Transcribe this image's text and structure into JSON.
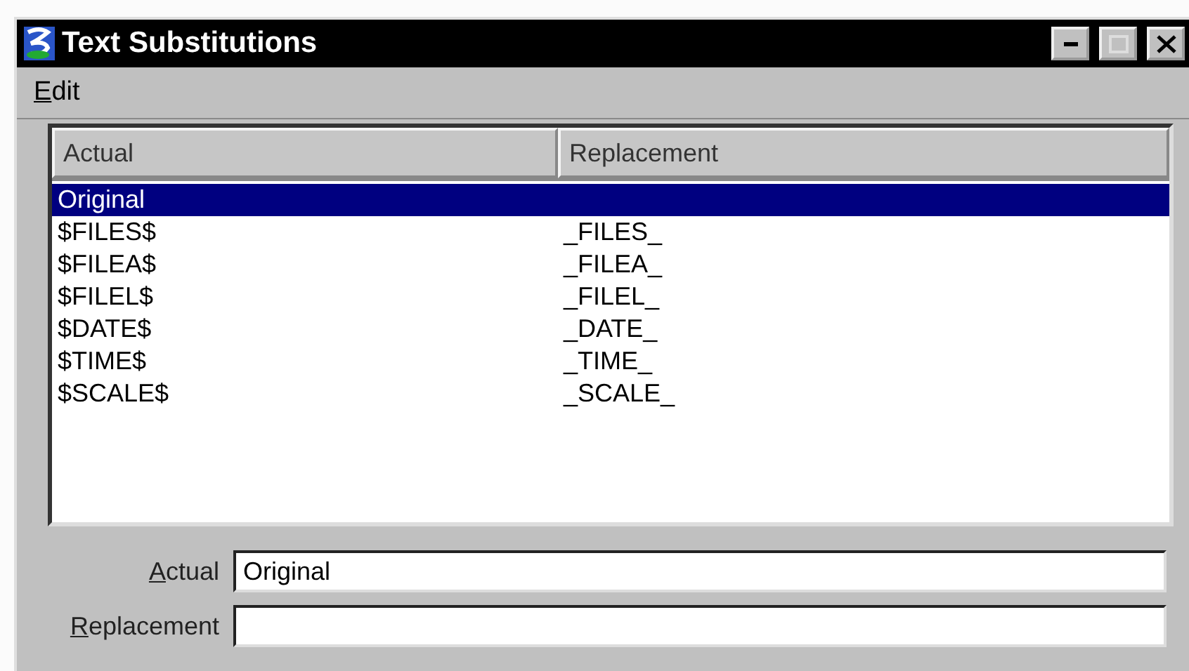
{
  "window": {
    "title": "Text Substitutions",
    "controls": [
      {
        "kind": "minimize"
      },
      {
        "kind": "maximize"
      },
      {
        "kind": "close"
      }
    ]
  },
  "menu": [
    "Edit"
  ],
  "table": {
    "columns": [
      "Actual",
      "Replacement"
    ],
    "rows": [
      {
        "actual": "Original",
        "selected": true
      },
      {
        "actual": "$FILES$",
        "replacement": "_FILES_",
        "selected": false
      },
      {
        "actual": "$FILEA$",
        "replacement": "_FILEA_",
        "selected": false
      },
      {
        "actual": "$FILEL$",
        "replacement": "_FILEL_",
        "selected": false
      },
      {
        "actual": "$DATE$",
        "replacement": "_DATE_",
        "selected": false
      },
      {
        "actual": "$TIME$",
        "replacement": "_TIME_",
        "selected": false
      },
      {
        "actual": "$SCALE$",
        "replacement": "_SCALE_",
        "selected": false
      }
    ]
  },
  "fields": [
    {
      "label": "Actual",
      "value": "Original"
    },
    {
      "label": "Replacement"
    }
  ]
}
